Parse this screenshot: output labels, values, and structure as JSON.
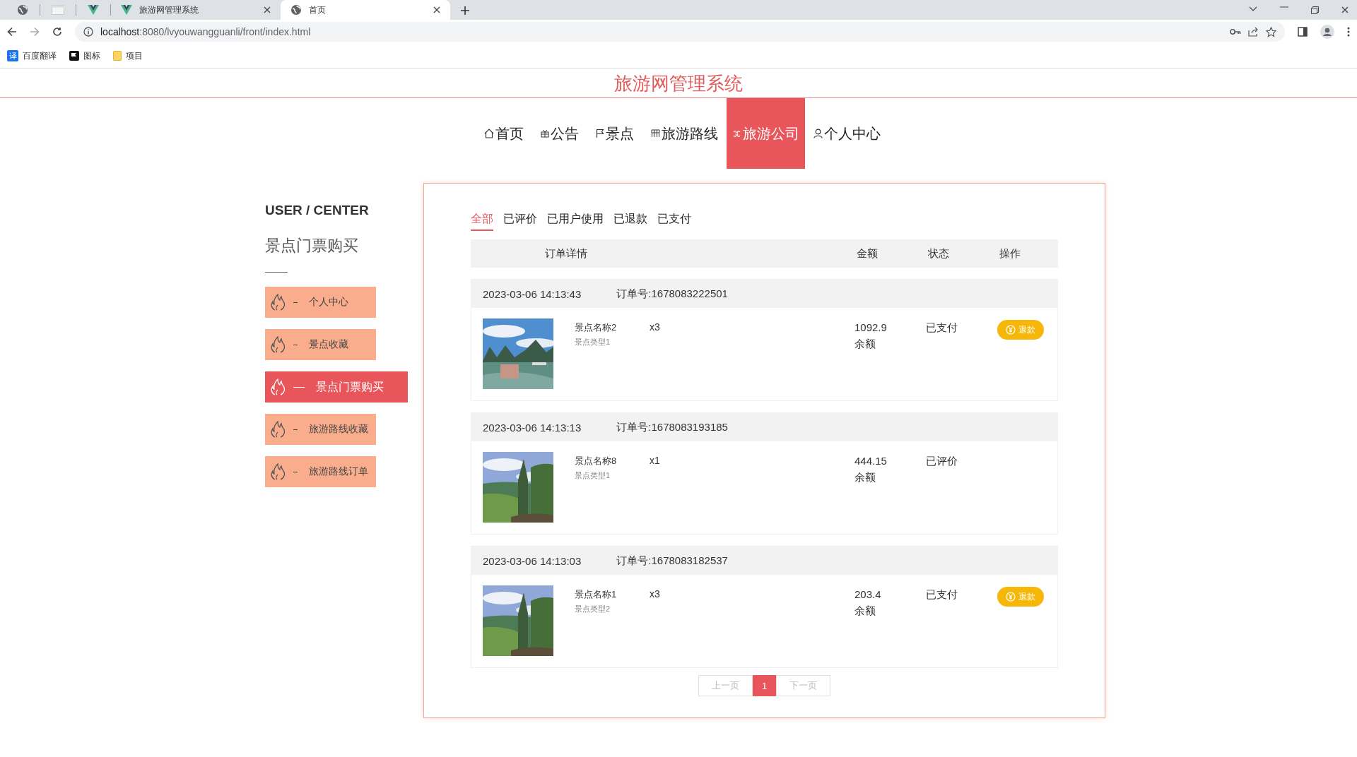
{
  "browser": {
    "tabs": [
      {
        "kind": "globe",
        "selected": false
      },
      {
        "kind": "blank",
        "selected": false
      },
      {
        "kind": "vue",
        "selected": false
      },
      {
        "kind": "vue",
        "label": "旅游网管理系统",
        "selected": false
      },
      {
        "kind": "globe",
        "label": "首页",
        "selected": true
      }
    ],
    "url_host": "localhost",
    "url_rest": ":8080/lvyouwangguanli/front/index.html",
    "bookmarks": [
      {
        "kind": "translate",
        "icon_text": "译",
        "label": "百度翻译"
      },
      {
        "kind": "flag",
        "label": "图标"
      },
      {
        "kind": "folder",
        "label": "项目"
      }
    ]
  },
  "site_title": "旅游网管理系统",
  "nav": [
    {
      "kind": "home",
      "label": "首页",
      "selected": false
    },
    {
      "kind": "gift",
      "label": "公告",
      "selected": false
    },
    {
      "kind": "flag",
      "label": "景点",
      "selected": false
    },
    {
      "kind": "grid",
      "label": "旅游路线",
      "selected": false
    },
    {
      "kind": "company",
      "label": "旅游公司",
      "selected": true
    },
    {
      "kind": "person",
      "label": "个人中心",
      "selected": false
    }
  ],
  "sidebar": {
    "heading": "USER / CENTER",
    "subtitle": "景点门票购买",
    "items": [
      {
        "label": "个人中心",
        "selected": false
      },
      {
        "label": "景点收藏",
        "selected": false
      },
      {
        "label": "景点门票购买",
        "selected": true
      },
      {
        "label": "旅游路线收藏",
        "selected": false
      },
      {
        "label": "旅游路线订单",
        "selected": false
      }
    ]
  },
  "filters": [
    {
      "label": "全部",
      "selected": true
    },
    {
      "label": "已评价",
      "selected": false
    },
    {
      "label": "已用户使用",
      "selected": false
    },
    {
      "label": "已退款",
      "selected": false
    },
    {
      "label": "已支付",
      "selected": false
    }
  ],
  "columns": [
    "订单详情",
    "金额",
    "状态",
    "操作"
  ],
  "orders": [
    {
      "time": "2023-03-06 14:13:43",
      "order_no": "订单号:1678083222501",
      "name": "景点名称2",
      "type": "景点类型1",
      "qty": "x3",
      "amount": "1092.9",
      "pay": "余额",
      "status": "已支付",
      "action": "退款"
    },
    {
      "time": "2023-03-06 14:13:13",
      "order_no": "订单号:1678083193185",
      "name": "景点名称8",
      "type": "景点类型1",
      "qty": "x1",
      "amount": "444.15",
      "pay": "余额",
      "status": "已评价"
    },
    {
      "time": "2023-03-06 14:13:03",
      "order_no": "订单号:1678083182537",
      "name": "景点名称1",
      "type": "景点类型2",
      "qty": "x3",
      "amount": "203.4",
      "pay": "余额",
      "status": "已支付",
      "action": "退款"
    }
  ],
  "pagination": {
    "prev": "上一页",
    "pages": [
      {
        "label": "1",
        "selected": true
      }
    ],
    "next": "下一页"
  }
}
